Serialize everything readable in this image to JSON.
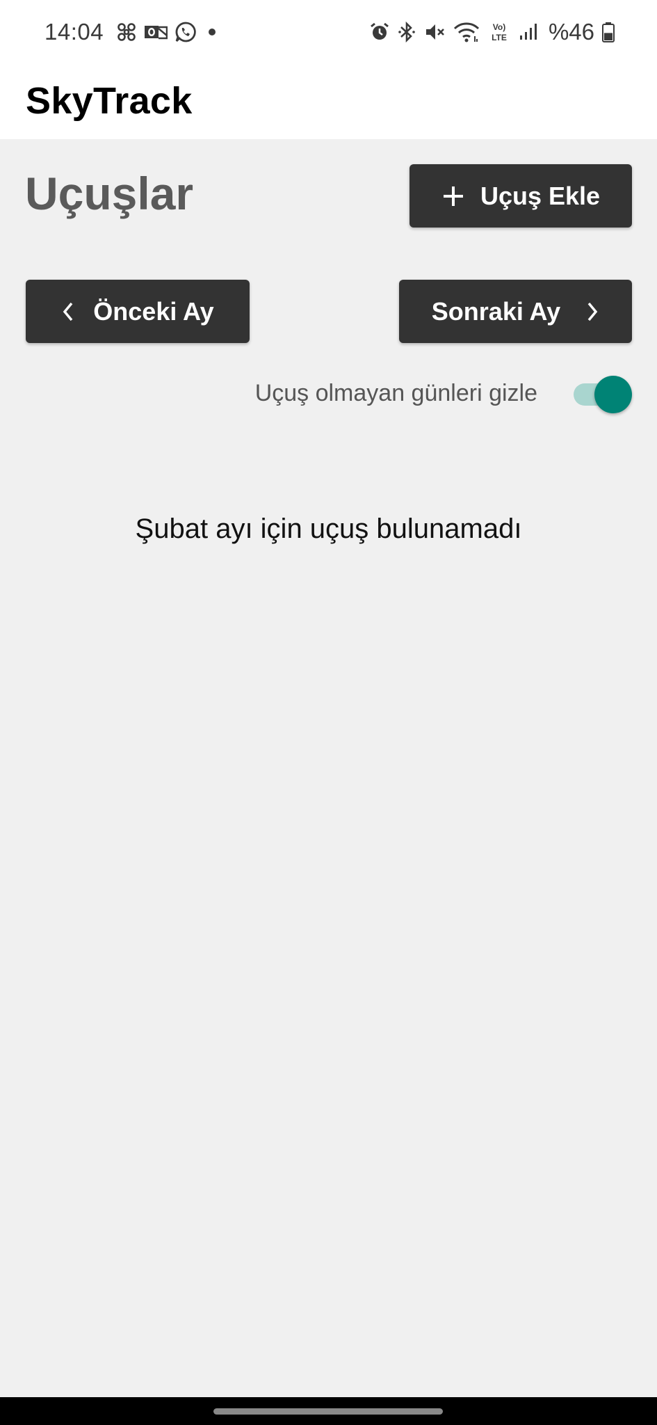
{
  "status_bar": {
    "time": "14:04",
    "left_icons": [
      "fan-icon",
      "outlook-icon",
      "whatsapp-icon",
      "dot-icon"
    ],
    "right_icons": [
      "alarm-icon",
      "bluetooth-icon",
      "mute-icon",
      "wifi-icon",
      "volte-icon",
      "signal-icon"
    ],
    "volte_top": "Vo)",
    "volte_bottom": "LTE",
    "battery_text": "%46",
    "battery_level": 0.46
  },
  "app_bar": {
    "title": "SkyTrack"
  },
  "main": {
    "page_title": "Uçuşlar",
    "add_button_label": "Uçuş Ekle",
    "prev_month_label": "Önceki Ay",
    "next_month_label": "Sonraki Ay",
    "hide_empty_days_label": "Uçuş olmayan günleri gizle",
    "hide_empty_days_on": true,
    "empty_message": "Şubat ayı için uçuş bulunamadı"
  },
  "colors": {
    "accent": "#008375",
    "accent_track": "#a9d5cf",
    "button_bg": "#333333",
    "background": "#f0f0f0"
  }
}
